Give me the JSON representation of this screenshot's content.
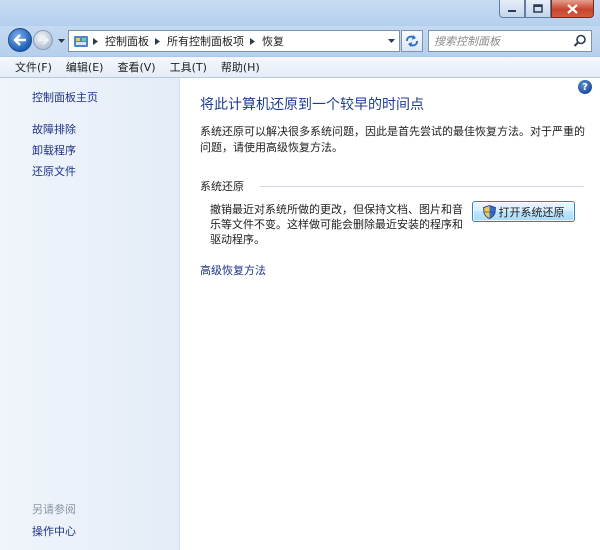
{
  "navigation": {
    "breadcrumbs": [
      "控制面板",
      "所有控制面板项",
      "恢复"
    ],
    "search_placeholder": "搜索控制面板"
  },
  "menu": [
    "文件(F)",
    "编辑(E)",
    "查看(V)",
    "工具(T)",
    "帮助(H)"
  ],
  "left_pane": {
    "home": "控制面板主页",
    "links": [
      "故障排除",
      "卸载程序",
      "还原文件"
    ],
    "see_also_heading": "另请参阅",
    "see_also_links": [
      "操作中心"
    ]
  },
  "content": {
    "help_label": "?",
    "title": "将此计算机还原到一个较早的时间点",
    "intro": "系统还原可以解决很多系统问题，因此是首先尝试的最佳恢复方法。对于严重的问题，请使用高级恢复方法。",
    "section_label": "系统还原",
    "restore_desc": "撤销最近对系统所做的更改，但保持文档、图片和音乐等文件不变。这样做可能会删除最近安装的程序和驱动程序。",
    "restore_button": "打开系统还原",
    "advanced_link": "高级恢复方法"
  },
  "colors": {
    "link": "#1e3287",
    "title": "#1e3d8f",
    "window_frame": "#a9c9ec"
  }
}
